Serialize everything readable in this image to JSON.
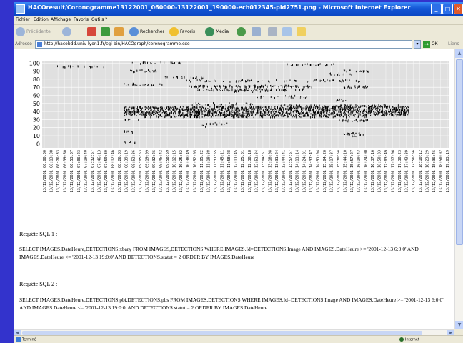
{
  "window": {
    "title": "HACOresult/Coronogramme13122001_060000-13122001_190000-ech012345-pid2751.png - Microsoft Internet Explorer"
  },
  "menu": [
    "Fichier",
    "Edition",
    "Affichage",
    "Favoris",
    "Outils",
    "?"
  ],
  "toolbar": {
    "back": "Précédente",
    "search": "Rechercher",
    "favorites": "Favoris",
    "media": "Média"
  },
  "address": {
    "label": "Adresse",
    "url": "http://hacobdd.univ-lyon1.fr/cgi-bin/HACOgraph/coronogramme.exe",
    "go": "OK",
    "links": "Liens"
  },
  "chart_data": {
    "type": "scatter",
    "title": "",
    "xlabel": "",
    "ylabel": "",
    "ylim": [
      -5,
      102
    ],
    "yticks": [
      0,
      10,
      20,
      30,
      40,
      50,
      60,
      70,
      80,
      90,
      100
    ],
    "xticks": [
      "13/12/2001 06:00:00",
      "13/12/2001 06:13:08",
      "13/12/2001 06:26:33",
      "13/12/2001 06:39:50",
      "13/12/2001 06:53:07",
      "13/12/2001 07:06:23",
      "13/12/2001 07:19:40",
      "13/12/2001 07:32:57",
      "13/12/2001 07:46:13",
      "13/12/2001 07:59:30",
      "13/12/2001 08:12:46",
      "13/12/2001 08:26:03",
      "13/12/2001 08:39:19",
      "13/12/2001 08:52:36",
      "13/12/2001 09:05:53",
      "13/12/2001 09:19:09",
      "13/12/2001 09:32:26",
      "13/12/2001 09:45:42",
      "13/12/2001 09:58:59",
      "13/12/2001 10:12:15",
      "13/12/2001 10:25:32",
      "13/12/2001 10:38:49",
      "13/12/2001 10:52:05",
      "13/12/2001 11:05:22",
      "13/12/2001 11:18:38",
      "13/12/2001 11:31:55",
      "13/12/2001 11:45:11",
      "13/12/2001 11:58:28",
      "13/12/2001 12:11:45",
      "13/12/2001 12:25:01",
      "13/12/2001 12:38:18",
      "13/12/2001 12:51:34",
      "13/12/2001 13:04:51",
      "13/12/2001 13:18:08",
      "13/12/2001 13:31:24",
      "13/12/2001 13:44:41",
      "13/12/2001 13:57:57",
      "13/12/2001 14:11:14",
      "13/12/2001 14:24:31",
      "13/12/2001 14:37:47",
      "13/12/2001 14:51:04",
      "13/12/2001 15:04:20",
      "13/12/2001 15:17:37",
      "13/12/2001 15:30:54",
      "13/12/2001 15:44:10",
      "13/12/2001 15:57:27",
      "13/12/2001 16:10:43",
      "13/12/2001 16:24:00",
      "13/12/2001 16:37:16",
      "13/12/2001 16:50:33",
      "13/12/2001 17:03:49",
      "13/12/2001 17:17:06",
      "13/12/2001 17:30:23",
      "13/12/2001 17:43:39",
      "13/12/2001 17:56:56",
      "13/12/2001 18:10:12",
      "13/12/2001 18:23:29",
      "13/12/2001 18:36:46",
      "13/12/2001 18:50:02",
      "13/12/2001 19:03:19"
    ],
    "bands": [
      {
        "y": 100,
        "from": 0.22,
        "to": 0.34,
        "density": 0.25
      },
      {
        "y": 98,
        "from": 0.6,
        "to": 0.72,
        "density": 0.3
      },
      {
        "y": 95,
        "from": 0.02,
        "to": 0.16,
        "density": 0.2
      },
      {
        "y": 90,
        "from": 0.2,
        "to": 0.28,
        "density": 0.35
      },
      {
        "y": 90,
        "from": 0.74,
        "to": 0.8,
        "density": 0.4
      },
      {
        "y": 86,
        "from": 0.7,
        "to": 0.76,
        "density": 0.35
      },
      {
        "y": 82,
        "from": 0.3,
        "to": 0.4,
        "density": 0.3
      },
      {
        "y": 78,
        "from": 0.35,
        "to": 0.78,
        "density": 0.25
      },
      {
        "y": 73,
        "from": 0.2,
        "to": 0.3,
        "density": 0.35
      },
      {
        "y": 71,
        "from": 0.36,
        "to": 0.67,
        "density": 0.6
      },
      {
        "y": 70,
        "from": 0.74,
        "to": 0.8,
        "density": 0.7
      },
      {
        "y": 67,
        "from": 0.38,
        "to": 0.64,
        "density": 0.4
      },
      {
        "y": 65,
        "from": 0.46,
        "to": 0.56,
        "density": 0.3
      },
      {
        "y": 58,
        "from": 0.52,
        "to": 0.65,
        "density": 0.25
      },
      {
        "y": 54,
        "from": 0.72,
        "to": 0.76,
        "density": 0.3
      },
      {
        "y": 49,
        "from": 0.36,
        "to": 0.52,
        "density": 0.3
      },
      {
        "y": 47,
        "from": 0.58,
        "to": 0.88,
        "density": 0.35
      },
      {
        "y": 45,
        "from": 0.2,
        "to": 0.9,
        "density": 0.85
      },
      {
        "y": 42,
        "from": 0.2,
        "to": 0.9,
        "density": 0.8
      },
      {
        "y": 39,
        "from": 0.2,
        "to": 0.9,
        "density": 0.9
      },
      {
        "y": 36,
        "from": 0.2,
        "to": 0.9,
        "density": 0.7
      },
      {
        "y": 34,
        "from": 0.25,
        "to": 0.8,
        "density": 0.45
      },
      {
        "y": 30,
        "from": 0.2,
        "to": 0.24,
        "density": 0.3
      },
      {
        "y": 29,
        "from": 0.72,
        "to": 0.8,
        "density": 0.5
      },
      {
        "y": 25,
        "from": 0.4,
        "to": 0.46,
        "density": 0.25
      },
      {
        "y": 22,
        "from": 0.39,
        "to": 0.4,
        "density": 0.6
      },
      {
        "y": 15,
        "from": 0.2,
        "to": 0.23,
        "density": 0.3
      },
      {
        "y": 12,
        "from": 0.74,
        "to": 0.79,
        "density": 0.6
      },
      {
        "y": 10,
        "from": 0.76,
        "to": 0.78,
        "density": 0.5
      },
      {
        "y": 2,
        "from": 0.2,
        "to": 0.23,
        "density": 0.3
      }
    ]
  },
  "sql": {
    "label1": "Requête SQL 1 :",
    "query1": "SELECT IMAGES.DateHeure,DETECTIONS.xbary FROM IMAGES,DETECTIONS WHERE IMAGES.Id=DETECTIONS.Image AND IMAGES.DateHeure >= '2001-12-13 6:0:0' AND IMAGES.DateHeure <= '2001-12-13 19:0:0' AND DETECTIONS.statut = 2 ORDER BY IMAGES.DateHeure",
    "label2": "Requête SQL 2 :",
    "query2": "SELECT IMAGES.DateHeure,DETECTIONS.pbi,DETECTIONS.pbs FROM IMAGES,DETECTIONS WHERE IMAGES.Id=DETECTIONS.Image AND IMAGES.DateHeure >= '2001-12-13 6:0:0' AND IMAGES.DateHeure <= '2001-12-13 19:0:0' AND DETECTIONS.statut = 2 ORDER BY IMAGES.DateHeure"
  },
  "status": {
    "left": "Terminé",
    "zone": "Internet"
  }
}
